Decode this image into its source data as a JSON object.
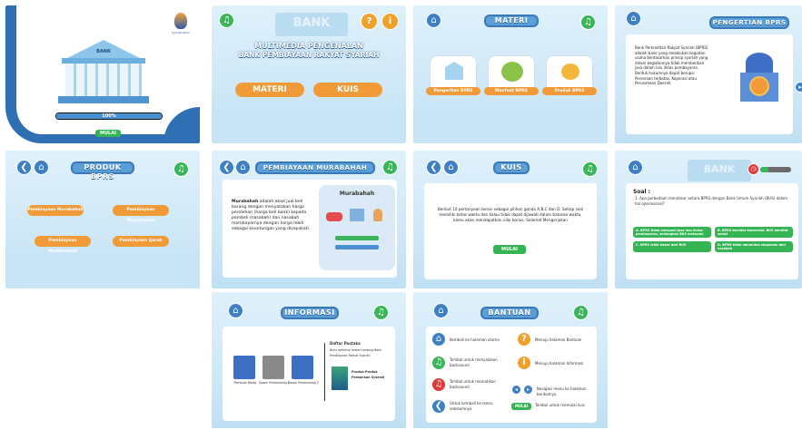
{
  "screens": {
    "splash": {
      "bank_sign": "BANK",
      "progress_percent": "100%",
      "progress_value": 1.0,
      "button": "MULAI",
      "logo_caption": "Syariah Bank"
    },
    "home": {
      "bg_sign": "BANK",
      "title_line1": "MULTIMEDIA PENGENALAN",
      "title_line2": "BANK PEMBIAYAAN RAKYAT SYARIAH",
      "materi_button": "MATERI",
      "kuis_button": "KUIS",
      "help_icon": "?",
      "info_icon": "i"
    },
    "materi": {
      "title": "MATERI",
      "items": [
        "Pengertian BPRS",
        "Manfaat BPRS",
        "Produk BPRS"
      ]
    },
    "pengertian": {
      "title": "PENGERTIAN BPRS",
      "text": "Bank Perkreditan Rakyat Syariah (BPRS) adalah bank yang melakukan kegiatan usaha berdasarkan prinsip syariah yang dalam kegiatannya tidak memberikan jasa dalam lalu lintas pembayaran. Bentuk hukumnya dapat berupa: Perseroan terbatas, Koperasi atau Perusahaan Daerah."
    },
    "produk": {
      "title": "PRODUK BPRS",
      "items": [
        "Pembiayaan Murabahah",
        "Pembiayaan Musyarakah",
        "Pembiayaan Mudharabah",
        "Pembiayaan Ijarah"
      ]
    },
    "murabahah": {
      "title": "PEMBIAYAAN MURABAHAH",
      "text_bold": "Murabahah",
      "text": " adalah akad jual beli barang dengan menyatakan harga perolehan (harga beli bank) kepada pembeli (nasabah) dan nasabah membayarnya dengan harga lebih sebagai keuntungan yang disepakati.",
      "diagram_title": "Murabahah"
    },
    "kuis": {
      "title": "KUIS",
      "text": "Berikut 10 pertanyaan benar sebagai pilihan ganda A,B,C dan D. Setiap soal memiliki batas waktu dan kalau tidak dapat dijawab dalam batasan waktu, kamu akan mendapatkan nilai bonus. Selamat Mengerjakan",
      "button": "MULAI"
    },
    "soal": {
      "bg_sign": "BANK",
      "label": "Soal :",
      "question": "1. Apa perbedaan mendasar antara BPRS dengan Bank Umum Syariah (BUS) dalam hal operasional?",
      "options": [
        "A. BPRS tidak melayani jasa lalu lintas pembayaran, sedangkan BUS melayani",
        "B. BPRS bersifat komersial, BUS bersifat sosial",
        "C. BPRS lebih besar dari BUS",
        "D. BPRS tidak menerima simpanan dari nasabah"
      ],
      "timer_value": 0.25
    },
    "informasi": {
      "title": "INFORMASI",
      "people": [
        "Pembuat Media",
        "Dosen Pembimbing 1",
        "Dosen Pembimbing 2"
      ],
      "book_header": "Daftar Pustaka",
      "book_text": "Buku referensi materi tentang Bank Pembiayaan Rakyat Syariah",
      "book_title": "Produk-Produk Perbankan Syariah"
    },
    "bantuan": {
      "title": "BANTUAN",
      "left": [
        "Kembali ke halaman utama",
        "Tombol untuk menyalakan backsound",
        "Tombol untuk mematikan backsound",
        "Untuk kembali ke menu sebelumnya"
      ],
      "right": [
        "Menuju halaman Bantuan",
        "Menuju halaman Informasi",
        "Navigasi menu ke halaman berikutnya",
        "Tombol untuk memulai kuis"
      ],
      "mulai_label": "MULAI"
    }
  },
  "icons": {
    "home": "home-icon",
    "back": "back-arrow-icon",
    "sound": "speaker-icon",
    "help": "question-icon",
    "info": "info-icon",
    "next": "next-arrow-icon"
  },
  "colors": {
    "blue": "#3f7fc4",
    "green": "#3cb55a",
    "orange": "#f0a12a"
  }
}
